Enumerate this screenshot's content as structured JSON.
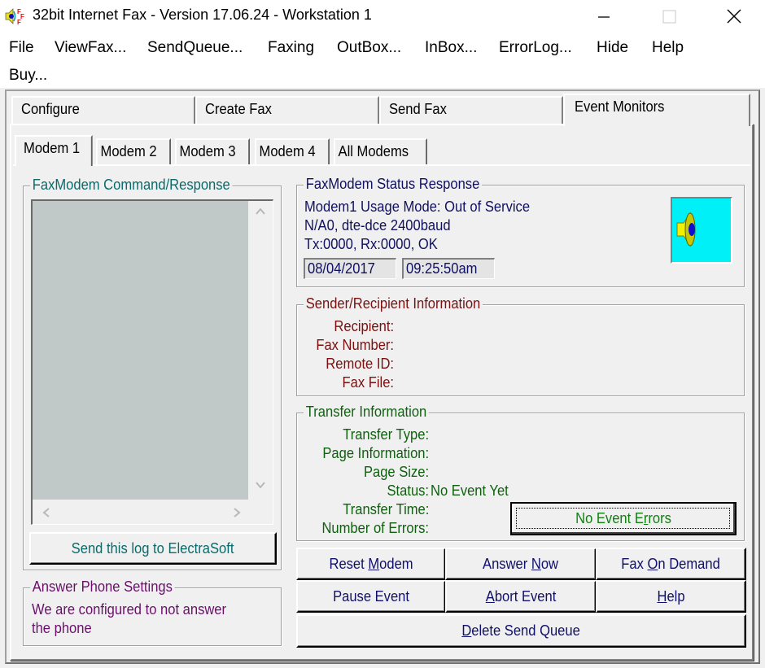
{
  "window": {
    "title": "32bit Internet Fax - Version 17.06.24 - Workstation 1",
    "icon": "fax-speaker-icon",
    "controls": {
      "minimize": "minimize-icon",
      "maximize": "maximize-icon",
      "close": "close-icon"
    }
  },
  "menu": [
    {
      "label": "File"
    },
    {
      "label": "ViewFax..."
    },
    {
      "label": "SendQueue..."
    },
    {
      "label": "Faxing"
    },
    {
      "label": "OutBox..."
    },
    {
      "label": "InBox..."
    },
    {
      "label": "ErrorLog..."
    },
    {
      "label": "Hide"
    },
    {
      "label": "Help"
    },
    {
      "label": "Buy..."
    }
  ],
  "outer_tabs": [
    {
      "label": "Configure",
      "active": false
    },
    {
      "label": "Create Fax",
      "active": false
    },
    {
      "label": "Send Fax",
      "active": false
    },
    {
      "label": "Event Monitors",
      "active": true
    }
  ],
  "inner_tabs": [
    {
      "label": "Modem 1",
      "active": true
    },
    {
      "label": "Modem 2",
      "active": false
    },
    {
      "label": "Modem 3",
      "active": false
    },
    {
      "label": "Modem 4",
      "active": false
    },
    {
      "label": "All Modems",
      "active": false
    }
  ],
  "command_response": {
    "title": "FaxModem Command/Response",
    "log_text": "",
    "send_log_button": "Send this log to ElectraSoft"
  },
  "answer_phone": {
    "title": "Answer Phone Settings",
    "text_line1": "We are configured to not answer",
    "text_line2": "the phone"
  },
  "status_response": {
    "title": "FaxModem Status Response",
    "line1": "Modem1 Usage Mode: Out of Service",
    "line2": "N/A0, dte-dce 2400baud",
    "line3": "Tx:0000, Rx:0000, OK",
    "date": "08/04/2017",
    "time": "09:25:50am",
    "speaker_icon": "speaker-icon"
  },
  "sender_recipient": {
    "title": "Sender/Recipient Information",
    "fields": [
      {
        "label": "Recipient:",
        "value": ""
      },
      {
        "label": "Fax Number:",
        "value": ""
      },
      {
        "label": "Remote ID:",
        "value": ""
      },
      {
        "label": "Fax File:",
        "value": ""
      }
    ]
  },
  "transfer": {
    "title": "Transfer Information",
    "fields": [
      {
        "label": "Transfer Type:",
        "value": ""
      },
      {
        "label": "Page Information:",
        "value": ""
      },
      {
        "label": "Page Size:",
        "value": ""
      },
      {
        "label": "Status:",
        "value": "No Event Yet"
      },
      {
        "label": "Transfer Time:",
        "value": ""
      },
      {
        "label": "Number of Errors:",
        "value": ""
      }
    ],
    "errors_button": {
      "pre": "No Event E",
      "accel": "r",
      "post": "rors"
    }
  },
  "buttons": {
    "reset_modem": {
      "pre": "Reset ",
      "accel": "M",
      "post": "odem"
    },
    "answer_now": {
      "pre": "Answer ",
      "accel": "N",
      "post": "ow"
    },
    "fax_on_demand": {
      "pre": "Fax ",
      "accel": "O",
      "post": "n Demand"
    },
    "pause_event": {
      "pre": "Pause Event",
      "accel": "",
      "post": ""
    },
    "abort_event": {
      "pre": "",
      "accel": "A",
      "post": "bort Event"
    },
    "help": {
      "pre": "",
      "accel": "H",
      "post": "elp"
    },
    "delete_send_queue": {
      "pre": "",
      "accel": "D",
      "post": "elete Send Queue"
    }
  },
  "colors": {
    "command_title": "#0a6a6a",
    "status_text": "#101060",
    "sender_text": "#7a1010",
    "transfer_text": "#106010",
    "answer_text": "#6a106a",
    "speaker_bg": "#00f0f8",
    "log_bg": "#c0c8c8"
  }
}
